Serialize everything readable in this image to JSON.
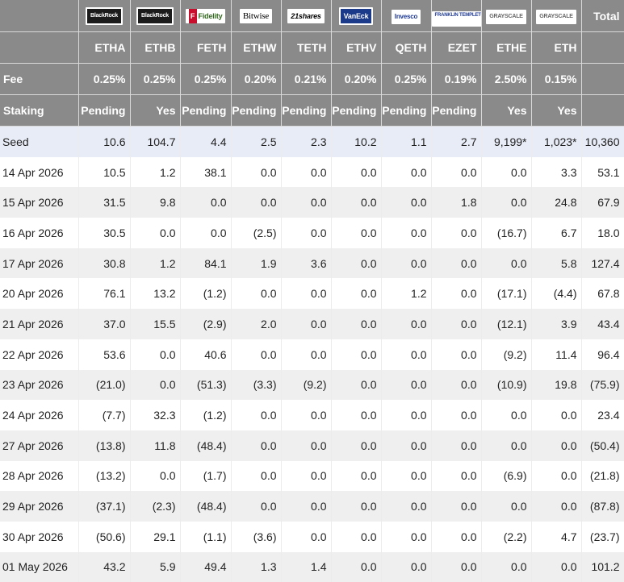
{
  "columns": [
    {
      "issuer": "BlackRock",
      "logo": "blackrock-logo",
      "ticker": "ETHA",
      "fee": "0.25%",
      "staking": "Pending"
    },
    {
      "issuer": "BlackRock",
      "logo": "blackrock-logo",
      "ticker": "ETHB",
      "fee": "0.25%",
      "staking": "Yes"
    },
    {
      "issuer": "Fidelity",
      "logo": "fidelity-logo",
      "ticker": "FETH",
      "fee": "0.25%",
      "staking": "Pending"
    },
    {
      "issuer": "Bitwise",
      "logo": "bitwise-logo",
      "ticker": "ETHW",
      "fee": "0.20%",
      "staking": "Pending"
    },
    {
      "issuer": "21shares",
      "logo": "21shares-logo",
      "ticker": "TETH",
      "fee": "0.21%",
      "staking": "Pending"
    },
    {
      "issuer": "VanEck",
      "logo": "vaneck-logo",
      "ticker": "ETHV",
      "fee": "0.20%",
      "staking": "Pending"
    },
    {
      "issuer": "Invesco",
      "logo": "invesco-logo",
      "ticker": "QETH",
      "fee": "0.25%",
      "staking": "Pending"
    },
    {
      "issuer": "FRANKLIN TEMPLETON",
      "logo": "franklin-templeton-logo",
      "ticker": "EZET",
      "fee": "0.19%",
      "staking": "Pending"
    },
    {
      "issuer": "GRAYSCALE",
      "logo": "grayscale-logo",
      "ticker": "ETHE",
      "fee": "2.50%",
      "staking": "Yes"
    },
    {
      "issuer": "GRAYSCALE",
      "logo": "grayscale-logo",
      "ticker": "ETH",
      "fee": "0.15%",
      "staking": "Yes"
    }
  ],
  "header": {
    "total_label": "Total",
    "fee_label": "Fee",
    "staking_label": "Staking"
  },
  "rows": [
    {
      "date": "Seed",
      "values": [
        "10.6",
        "104.7",
        "4.4",
        "2.5",
        "2.3",
        "10.2",
        "1.1",
        "2.7",
        "9,199*",
        "1,023*"
      ],
      "total": "10,360"
    },
    {
      "date": "14 Apr 2026",
      "values": [
        "10.5",
        "1.2",
        "38.1",
        "0.0",
        "0.0",
        "0.0",
        "0.0",
        "0.0",
        "0.0",
        "3.3"
      ],
      "total": "53.1"
    },
    {
      "date": "15 Apr 2026",
      "values": [
        "31.5",
        "9.8",
        "0.0",
        "0.0",
        "0.0",
        "0.0",
        "0.0",
        "1.8",
        "0.0",
        "24.8"
      ],
      "total": "67.9"
    },
    {
      "date": "16 Apr 2026",
      "values": [
        "30.5",
        "0.0",
        "0.0",
        "(2.5)",
        "0.0",
        "0.0",
        "0.0",
        "0.0",
        "(16.7)",
        "6.7"
      ],
      "total": "18.0"
    },
    {
      "date": "17 Apr 2026",
      "values": [
        "30.8",
        "1.2",
        "84.1",
        "1.9",
        "3.6",
        "0.0",
        "0.0",
        "0.0",
        "0.0",
        "5.8"
      ],
      "total": "127.4"
    },
    {
      "date": "20 Apr 2026",
      "values": [
        "76.1",
        "13.2",
        "(1.2)",
        "0.0",
        "0.0",
        "0.0",
        "1.2",
        "0.0",
        "(17.1)",
        "(4.4)"
      ],
      "total": "67.8"
    },
    {
      "date": "21 Apr 2026",
      "values": [
        "37.0",
        "15.5",
        "(2.9)",
        "2.0",
        "0.0",
        "0.0",
        "0.0",
        "0.0",
        "(12.1)",
        "3.9"
      ],
      "total": "43.4"
    },
    {
      "date": "22 Apr 2026",
      "values": [
        "53.6",
        "0.0",
        "40.6",
        "0.0",
        "0.0",
        "0.0",
        "0.0",
        "0.0",
        "(9.2)",
        "11.4"
      ],
      "total": "96.4"
    },
    {
      "date": "23 Apr 2026",
      "values": [
        "(21.0)",
        "0.0",
        "(51.3)",
        "(3.3)",
        "(9.2)",
        "0.0",
        "0.0",
        "0.0",
        "(10.9)",
        "19.8"
      ],
      "total": "(75.9)"
    },
    {
      "date": "24 Apr 2026",
      "values": [
        "(7.7)",
        "32.3",
        "(1.2)",
        "0.0",
        "0.0",
        "0.0",
        "0.0",
        "0.0",
        "0.0",
        "0.0"
      ],
      "total": "23.4"
    },
    {
      "date": "27 Apr 2026",
      "values": [
        "(13.8)",
        "11.8",
        "(48.4)",
        "0.0",
        "0.0",
        "0.0",
        "0.0",
        "0.0",
        "0.0",
        "0.0"
      ],
      "total": "(50.4)"
    },
    {
      "date": "28 Apr 2026",
      "values": [
        "(13.2)",
        "0.0",
        "(1.7)",
        "0.0",
        "0.0",
        "0.0",
        "0.0",
        "0.0",
        "(6.9)",
        "0.0"
      ],
      "total": "(21.8)"
    },
    {
      "date": "29 Apr 2026",
      "values": [
        "(37.1)",
        "(2.3)",
        "(48.4)",
        "0.0",
        "0.0",
        "0.0",
        "0.0",
        "0.0",
        "0.0",
        "0.0"
      ],
      "total": "(87.8)"
    },
    {
      "date": "30 Apr 2026",
      "values": [
        "(50.6)",
        "29.1",
        "(1.1)",
        "(3.6)",
        "0.0",
        "0.0",
        "0.0",
        "0.0",
        "(2.2)",
        "4.7"
      ],
      "total": "(23.7)"
    },
    {
      "date": "01 May 2026",
      "values": [
        "43.2",
        "5.9",
        "49.4",
        "1.3",
        "1.4",
        "0.0",
        "0.0",
        "0.0",
        "0.0",
        "0.0"
      ],
      "total": "101.2"
    }
  ]
}
